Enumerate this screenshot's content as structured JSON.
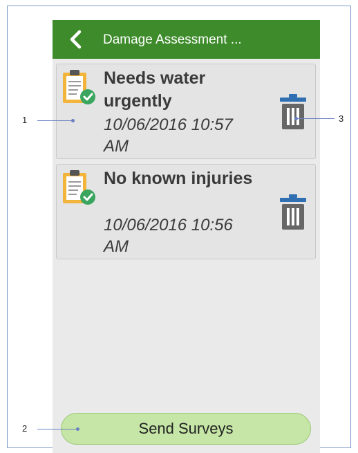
{
  "header": {
    "title": "Damage Assessment ...",
    "back_icon": "chevron-left-icon"
  },
  "surveys": [
    {
      "title": "Needs water urgently",
      "date": "10/06/2016 10:57 AM",
      "icon": "clipboard-check-icon",
      "delete_icon": "trash-icon"
    },
    {
      "title": "No known injuries",
      "date": "10/06/2016 10:56 AM",
      "icon": "clipboard-check-icon",
      "delete_icon": "trash-icon"
    }
  ],
  "send_button": {
    "label": "Send Surveys"
  },
  "callouts": {
    "one": "1",
    "two": "2",
    "three": "3"
  },
  "colors": {
    "header_bg": "#3d8b2a",
    "send_button_bg": "#c5e6a6",
    "trash_lid": "#2f6fb2",
    "trash_body": "#666666"
  }
}
